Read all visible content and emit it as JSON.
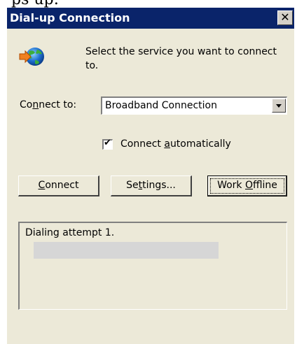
{
  "caption_fragment": "ps up:",
  "window": {
    "title": "Dial-up Connection",
    "close_glyph": "✕"
  },
  "icon": "dialup-connection-icon",
  "prompt": "Select the service you want to connect to.",
  "connect_to": {
    "label_pre": "Co",
    "label_key": "n",
    "label_post": "nect to:",
    "selected_value": "Broadband Connection"
  },
  "auto_connect": {
    "checked": true,
    "check_glyph": "✔",
    "label_pre": "Connect ",
    "label_key": "a",
    "label_post": "utomatically"
  },
  "buttons": {
    "connect": {
      "pre": "",
      "key": "C",
      "post": "onnect"
    },
    "settings": {
      "pre": "Se",
      "key": "t",
      "post": "tings..."
    },
    "work_offline": {
      "pre": "Work ",
      "key": "O",
      "post": "ffline"
    }
  },
  "status": {
    "lines": [
      "Dialing attempt 1."
    ]
  },
  "colors": {
    "titlebar": "#0a246a",
    "dialog_face": "#ece9d8",
    "redaction": "#d6d6d6"
  }
}
